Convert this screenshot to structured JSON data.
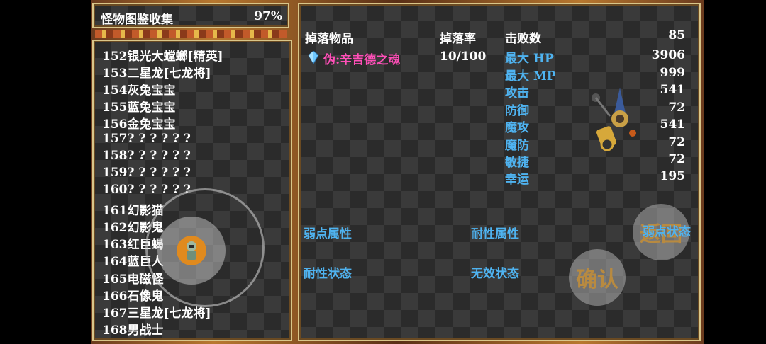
{
  "title": {
    "text": "怪物图鉴收集",
    "percent": "97%"
  },
  "list": [
    "152银光大螳螂[精英]",
    "153二星龙[七龙将]",
    "154灰兔宝宝",
    "155蓝兔宝宝",
    "156金兔宝宝",
    "157? ? ? ? ? ?",
    "158? ? ? ? ? ?",
    "159? ? ? ? ? ?",
    "160? ? ? ? ? ?",
    "161幻影猫",
    "162幻影鬼",
    "163红巨蝎",
    "164蓝巨人",
    "165电磁怪",
    "166石像鬼",
    "167三星龙[七龙将]",
    "168男战士"
  ],
  "selected_index": 13,
  "detail": {
    "drop_header": "掉落物品",
    "rate_header": "掉落率",
    "defeat_label": "击败数",
    "defeat_value": "85",
    "drop_item": "伪:辛吉德之魂",
    "drop_rate": "10/100",
    "stats": [
      {
        "label": "最大 HP",
        "value": "3906"
      },
      {
        "label": "最大 MP",
        "value": "999"
      },
      {
        "label": "攻击",
        "value": "541"
      },
      {
        "label": "防御",
        "value": "72"
      },
      {
        "label": "魔攻",
        "value": "541"
      },
      {
        "label": "魔防",
        "value": "72"
      },
      {
        "label": "敏捷",
        "value": "72"
      },
      {
        "label": "幸运",
        "value": "195"
      }
    ],
    "weak_attr": "弱点属性",
    "resist_attr": "耐性属性",
    "weak_status": "弱点状态",
    "resist_status": "耐性状态",
    "immune_status": "无效状态"
  },
  "buttons": {
    "back": "返回",
    "confirm": "确认"
  },
  "colors": {
    "stat_label": "#4fb3f0",
    "drop_item": "#ff4fb8",
    "panel_border": "#d9c68a"
  }
}
